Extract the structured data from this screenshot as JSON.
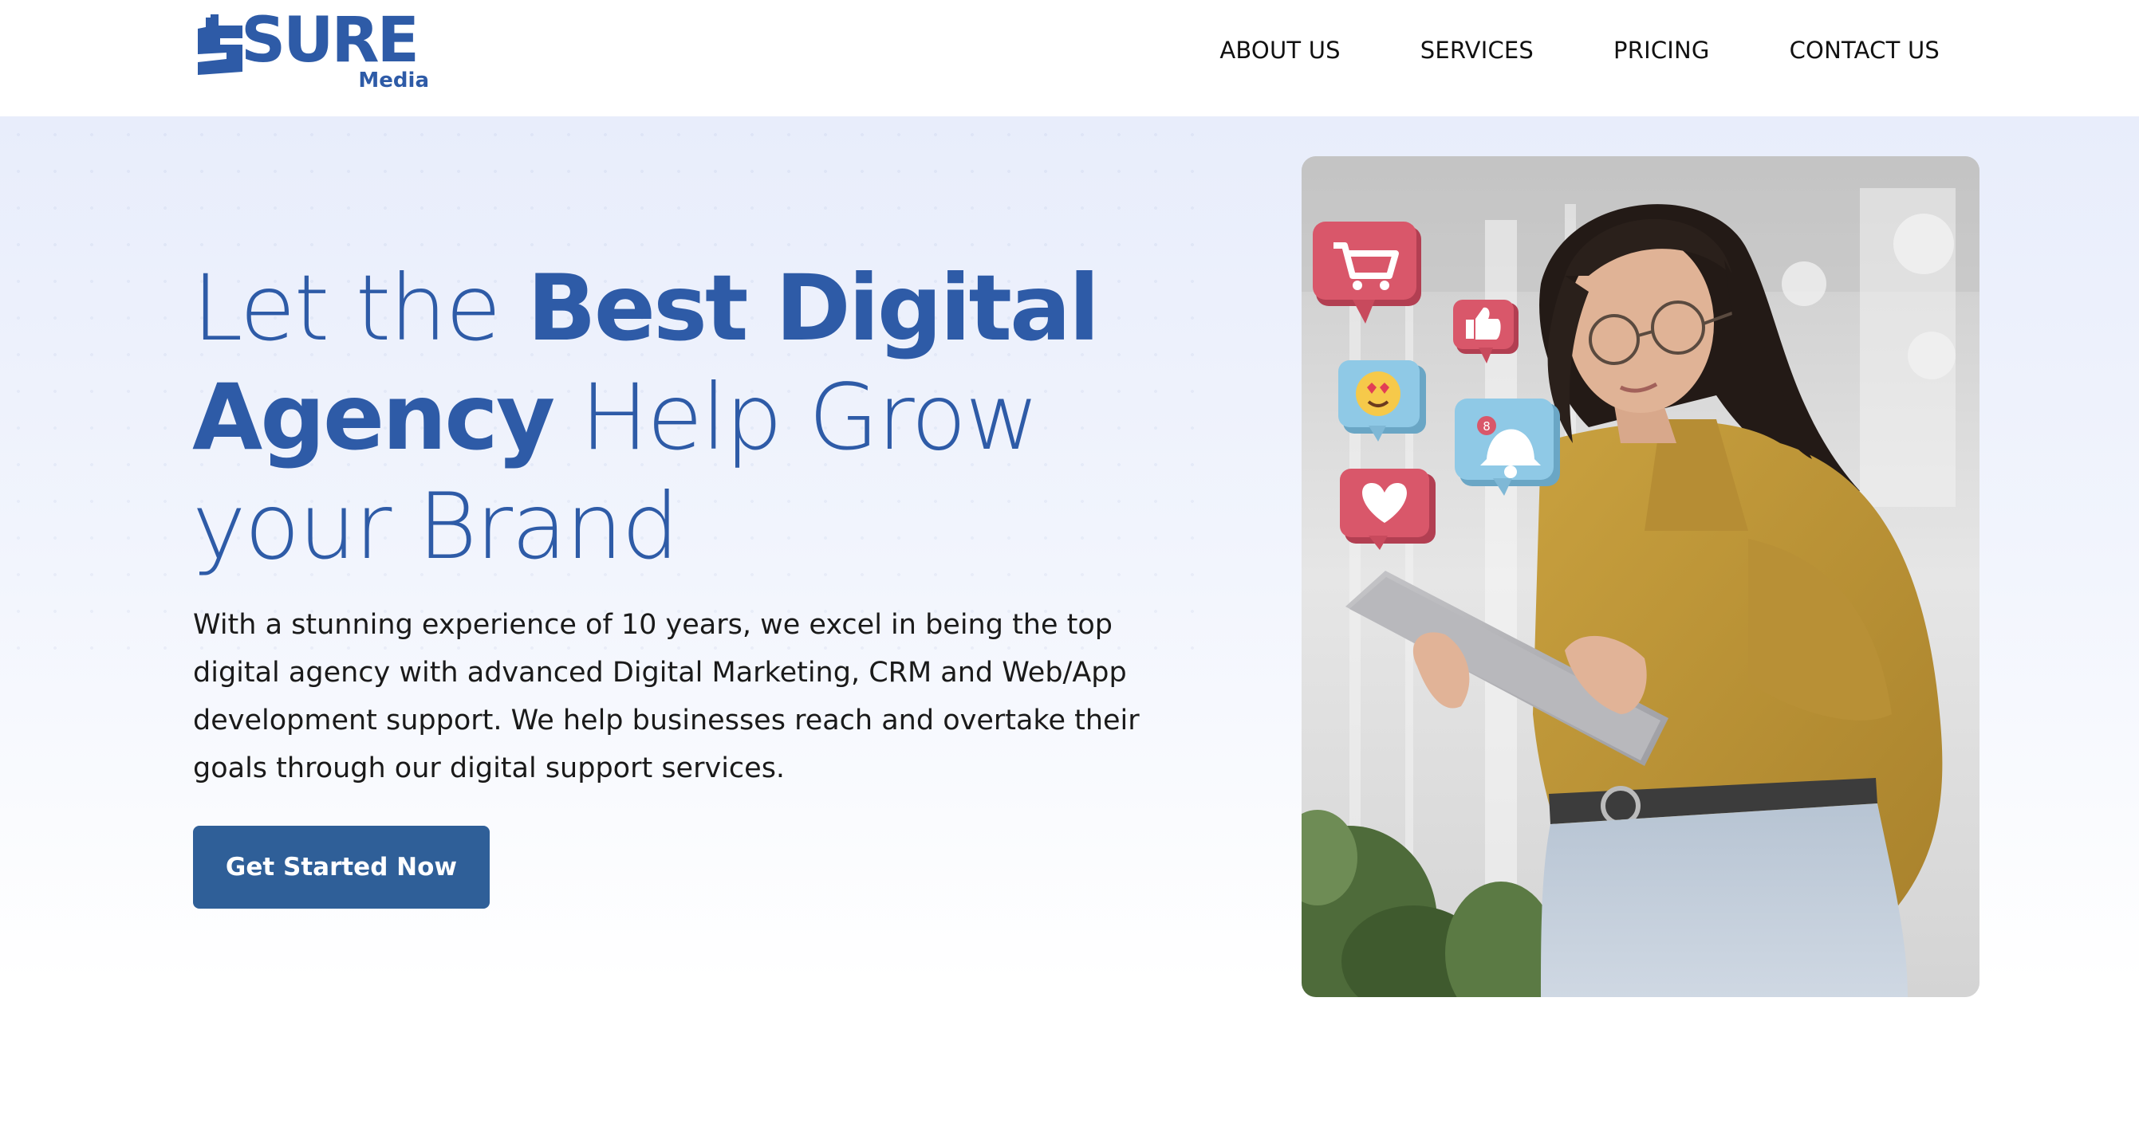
{
  "brand": {
    "name": "SURE",
    "sub": "Media",
    "color": "#2e5ba7"
  },
  "nav": {
    "items": [
      {
        "label": "ABOUT US"
      },
      {
        "label": "SERVICES"
      },
      {
        "label": "PRICING"
      },
      {
        "label": "CONTACT US"
      }
    ]
  },
  "hero": {
    "title_part1": "Let the ",
    "title_bold1": "Best Digital",
    "title_bold2": "Agency",
    "title_part2": " Help Grow",
    "title_part3": "your Brand",
    "description": "With a stunning experience of 10 years, we excel in being the top digital agency with advanced Digital Marketing, CRM and Web/App development support. We help businesses reach and overtake their goals through our digital support services.",
    "cta_label": "Get Started Now",
    "notification_count": "8"
  },
  "colors": {
    "accent": "#2e5ba7",
    "button": "#2f5f98",
    "hero_bg_top": "#e8edfb",
    "social_red": "#d9576a",
    "social_blue": "#8fc9e6"
  },
  "icons": {
    "social": [
      "cart-icon",
      "thumbs-up-icon",
      "heart-eyes-emoji-icon",
      "bell-icon",
      "heart-icon"
    ]
  }
}
